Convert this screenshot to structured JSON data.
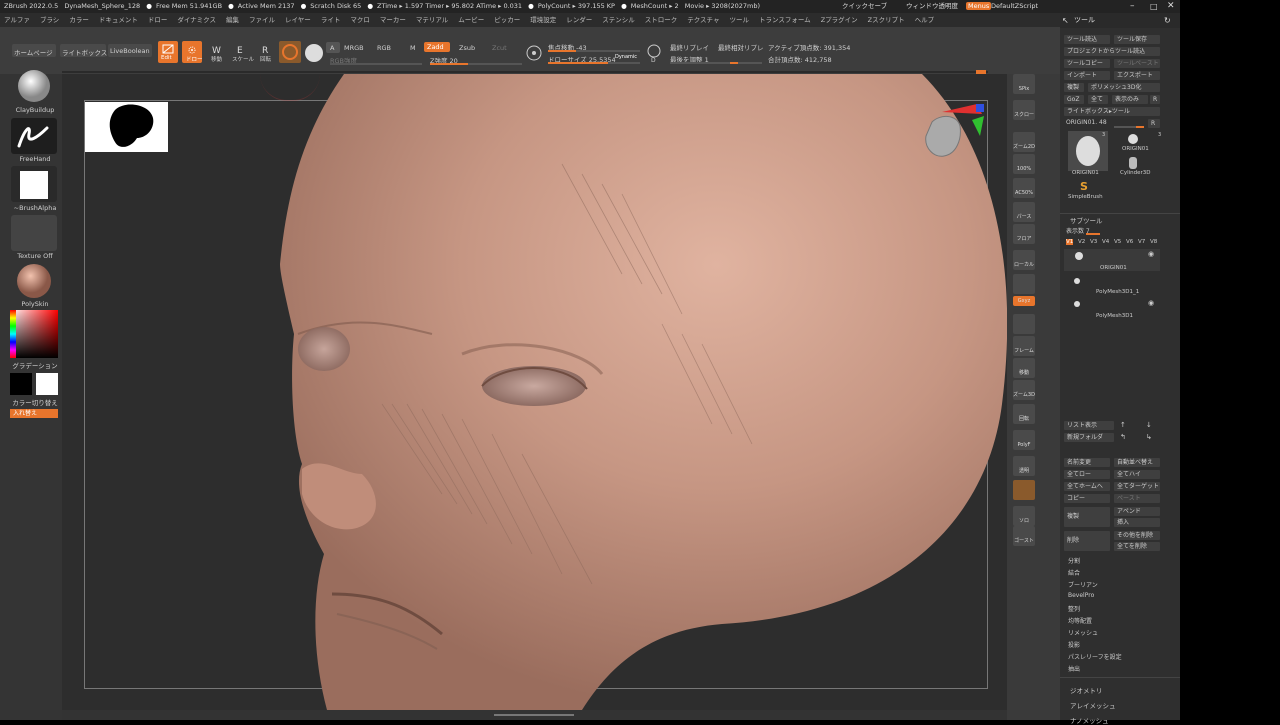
{
  "titlebar": {
    "app": "ZBrush 2022.0.5",
    "file": "DynaMesh_Sphere_128",
    "free_mem": "Free Mem 51.941GB",
    "active_mem": "Active Mem 2137",
    "scratch": "Scratch Disk 65",
    "ztime": "ZTime ▸ 1.597 Timer ▸ 95.802 ATime ▸ 0.031",
    "polycount": "PolyCount ▸ 397.155 KP",
    "meshcount": "MeshCount ▸ 2",
    "movie": "Movie ▸ 3208(2027mb)",
    "quicksave": "クイックセーブ",
    "window_transparency": "ウィンドウ透明度",
    "menus": "Menus",
    "script": "DefaultZScript"
  },
  "menubar": [
    "アルファ",
    "ブラシ",
    "カラー",
    "ドキュメント",
    "ドロー",
    "ダイナミクス",
    "編集",
    "ファイル",
    "レイヤー",
    "ライト",
    "マクロ",
    "マーカー",
    "マテリアル",
    "ムービー",
    "ピッカー",
    "環境設定",
    "レンダー",
    "ステンシル",
    "ストローク",
    "テクスチャ",
    "ツール",
    "トランスフォーム",
    "Zプラグイン",
    "Zスクリプト",
    "ヘルプ"
  ],
  "toolbar": {
    "home": "ホームページ",
    "lightbox": "ライトボックス",
    "liveboolean": "LiveBoolean",
    "edit": "Edit",
    "draw": "ドロー",
    "move": "移動",
    "scale": "スケール",
    "rotate": "回転",
    "a": "A",
    "mrgb": "MRGB",
    "rgb": "RGB",
    "m": "M",
    "zadd": "Zadd",
    "zsub": "Zsub",
    "zcut": "Zcut",
    "rgb_intensity": "RGB強度",
    "z_intensity": "Z強度 20",
    "focal_shift": "焦点移動 -43",
    "draw_size": "ドローサイズ 25.5354",
    "dynamic": "Dynamic",
    "last_replay": "最終リプレイ",
    "last_relative": "最終相対リプレ",
    "adjust_last": "最後を調整 1",
    "active_points": "アクティブ頂点数: 391,354",
    "total_points": "合計頂点数: 412,758"
  },
  "leftshelf": {
    "brush": "ClayBuildup",
    "stroke": "FreeHand",
    "alpha": "~BrushAlpha",
    "texture": "Texture Off",
    "material": "PolySkin",
    "gradient": "グラデーション",
    "switch_color": "カラー切り替え",
    "swap": "入れ替え"
  },
  "rightnav": [
    "SPix",
    "スクロール",
    "ズーム2D",
    "100%",
    "AC50%",
    "パース",
    "フロア",
    "ローカル",
    "",
    "Gxyz",
    "",
    "フレーム",
    "移動",
    "ズーム3D",
    "回転",
    "PolyF",
    "透明",
    "",
    "ソロ",
    "ゴースト"
  ],
  "panel": {
    "title": "ツール",
    "load": "ツール読込",
    "save": "ツール保存",
    "copy_project": "プロジェクトからツール読込",
    "copy_tool": "ツールコピー",
    "paste_tool": "ツールペースト",
    "import": "インポート",
    "export": "エクスポート",
    "clone": "複製",
    "make_polymesh": "ポリメッシュ3D化",
    "goz": "GoZ",
    "all": "全て",
    "visible": "表示のみ",
    "r": "R",
    "lightbox_tools": "ライトボックス▸ツール",
    "origin_label": "ORIGIN01. 48",
    "thumbs": [
      "ORIGIN01",
      "ORIGIN01",
      "Cylinder3D",
      "SimpleBrush"
    ],
    "thumb_count_a": "3",
    "thumb_count_b": "3",
    "subtool": "サブツール",
    "visible_count": "表示数 7",
    "v_tabs": [
      "V1",
      "V2",
      "V3",
      "V4",
      "V5",
      "V6",
      "V7",
      "V8"
    ],
    "subtools": [
      "ORIGIN01",
      "PolyMesh3D1_1",
      "PolyMesh3D1"
    ],
    "list_all": "リスト表示",
    "new_folder": "新規フォルダ",
    "rename": "名前変更",
    "auto_reorder": "自動並べ替え",
    "all_low": "全てロー",
    "all_high": "全てハイ",
    "all_home": "全てホームへ",
    "all_target": "全てターゲット",
    "copy": "コピー",
    "paste": "ペースト",
    "duplicate": "複製",
    "append": "アペンド",
    "insert": "挿入",
    "delete": "削除",
    "del_other": "その他を削除",
    "del_all": "全てを削除",
    "split": "分割",
    "merge": "結合",
    "boolean": "ブーリアン",
    "bevelpro": "BevelPro",
    "align": "整列",
    "distribute": "均等配置",
    "remesh": "リメッシュ",
    "project": "投影",
    "extract_polygroup": "パスレリーフを設定",
    "extract": "抽出",
    "geometry": "ジオメトリ",
    "arraymesh": "アレイメッシュ",
    "nanomesh": "ナノメッシュ"
  },
  "colors": {
    "accent": "#e8752c",
    "skin": "#c89a86"
  }
}
